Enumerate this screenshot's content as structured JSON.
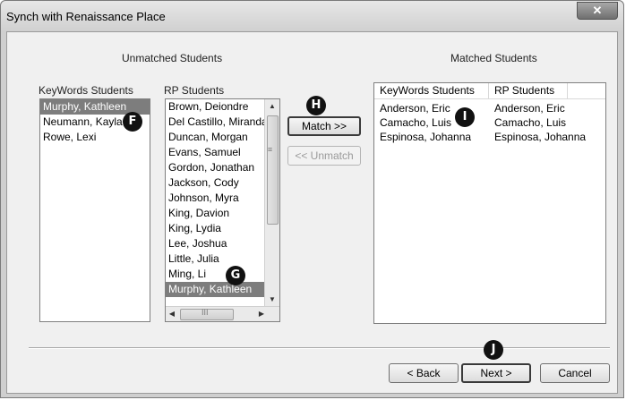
{
  "window": {
    "title": "Synch with Renaissance Place",
    "close_glyph": "✕"
  },
  "unmatched": {
    "heading": "Unmatched Students",
    "keywords_label": "KeyWords Students",
    "rp_label": "RP Students",
    "keywords_students": [
      "Murphy, Kathleen",
      "Neumann, Kayla",
      "Rowe, Lexi"
    ],
    "keywords_selected_index": 0,
    "rp_students": [
      "Brown, Deiondre",
      "Del Castillo, Miranda",
      "Duncan, Morgan",
      "Evans, Samuel",
      "Gordon, Jonathan",
      "Jackson, Cody",
      "Johnson, Myra",
      "King, Davion",
      "King, Lydia",
      "Lee, Joshua",
      "Little, Julia",
      "Ming, Li",
      "Murphy, Kathleen"
    ],
    "rp_selected_index": 12
  },
  "buttons": {
    "match": "Match >>",
    "unmatch": "<< Unmatch",
    "back": "< Back",
    "next": "Next >",
    "cancel": "Cancel"
  },
  "matched": {
    "heading": "Matched Students",
    "col_keywords": "KeyWords Students",
    "col_rp": "RP Students",
    "rows": [
      {
        "kw": "Anderson, Eric",
        "rp": "Anderson, Eric"
      },
      {
        "kw": "Camacho, Luis",
        "rp": "Camacho, Luis"
      },
      {
        "kw": "Espinosa, Johanna",
        "rp": "Espinosa, Johanna"
      }
    ]
  },
  "callouts": {
    "f": "F",
    "g": "G",
    "h": "H",
    "i": "I",
    "j": "J"
  },
  "scroll_glyphs": {
    "up": "▲",
    "down": "▼",
    "left": "◀",
    "right": "▶",
    "vgrip": "≡",
    "hgrip": "III"
  }
}
